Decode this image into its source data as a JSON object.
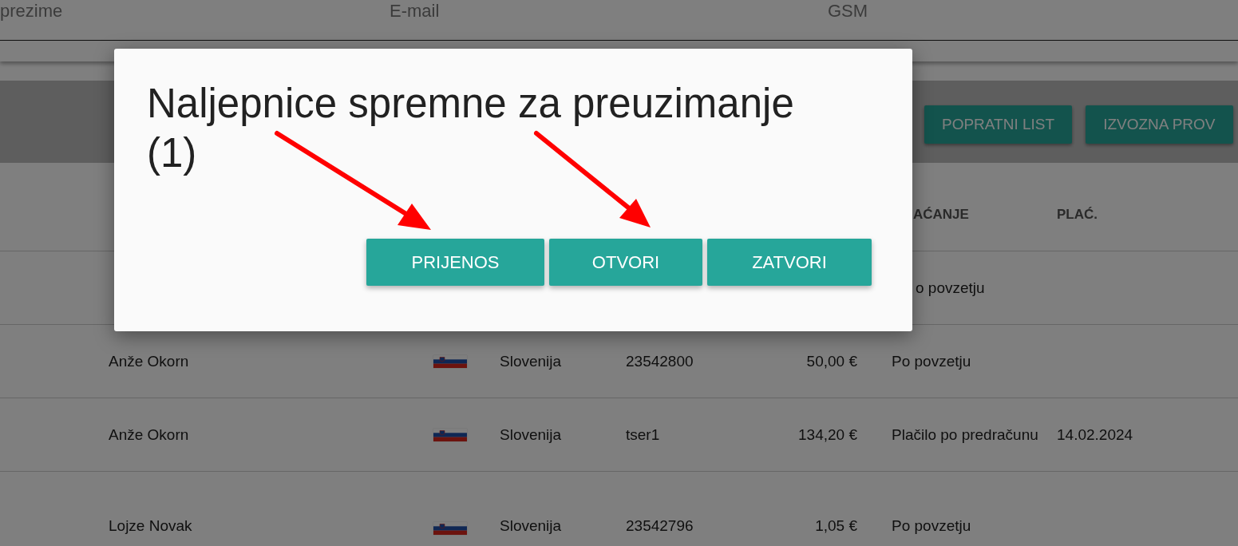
{
  "filters": [
    {
      "placeholder": "prezime"
    },
    {
      "placeholder": "E-mail"
    },
    {
      "placeholder": "GSM"
    }
  ],
  "toolbar": {
    "buttons": [
      "POPRATNI LIST",
      "IZVOZNA PROV"
    ]
  },
  "table": {
    "header": {
      "payment": "AĆANJE",
      "paid": "PLAĆ."
    },
    "partial_row": {
      "payment": "o povzetju"
    },
    "rows": [
      {
        "name": "Anže Okorn",
        "country": "Slovenija",
        "number": "23542800",
        "amount": "50,00 €",
        "payment": "Po povzetju"
      },
      {
        "name": "Anže Okorn",
        "country": "Slovenija",
        "number": "tser1",
        "amount": "134,20 €",
        "payment": "Plačilo po predračunu",
        "paid": "14.02.2024"
      },
      {
        "name": "Lojze Novak",
        "country": "Slovenija",
        "number": "23542796",
        "amount": "1,05 €",
        "payment": "Po povzetju"
      }
    ]
  },
  "dialog": {
    "title": "Naljepnice spremne za preuzimanje (1)",
    "buttons": [
      "PRIJENOS",
      "OTVORI",
      "ZATVORI"
    ]
  }
}
